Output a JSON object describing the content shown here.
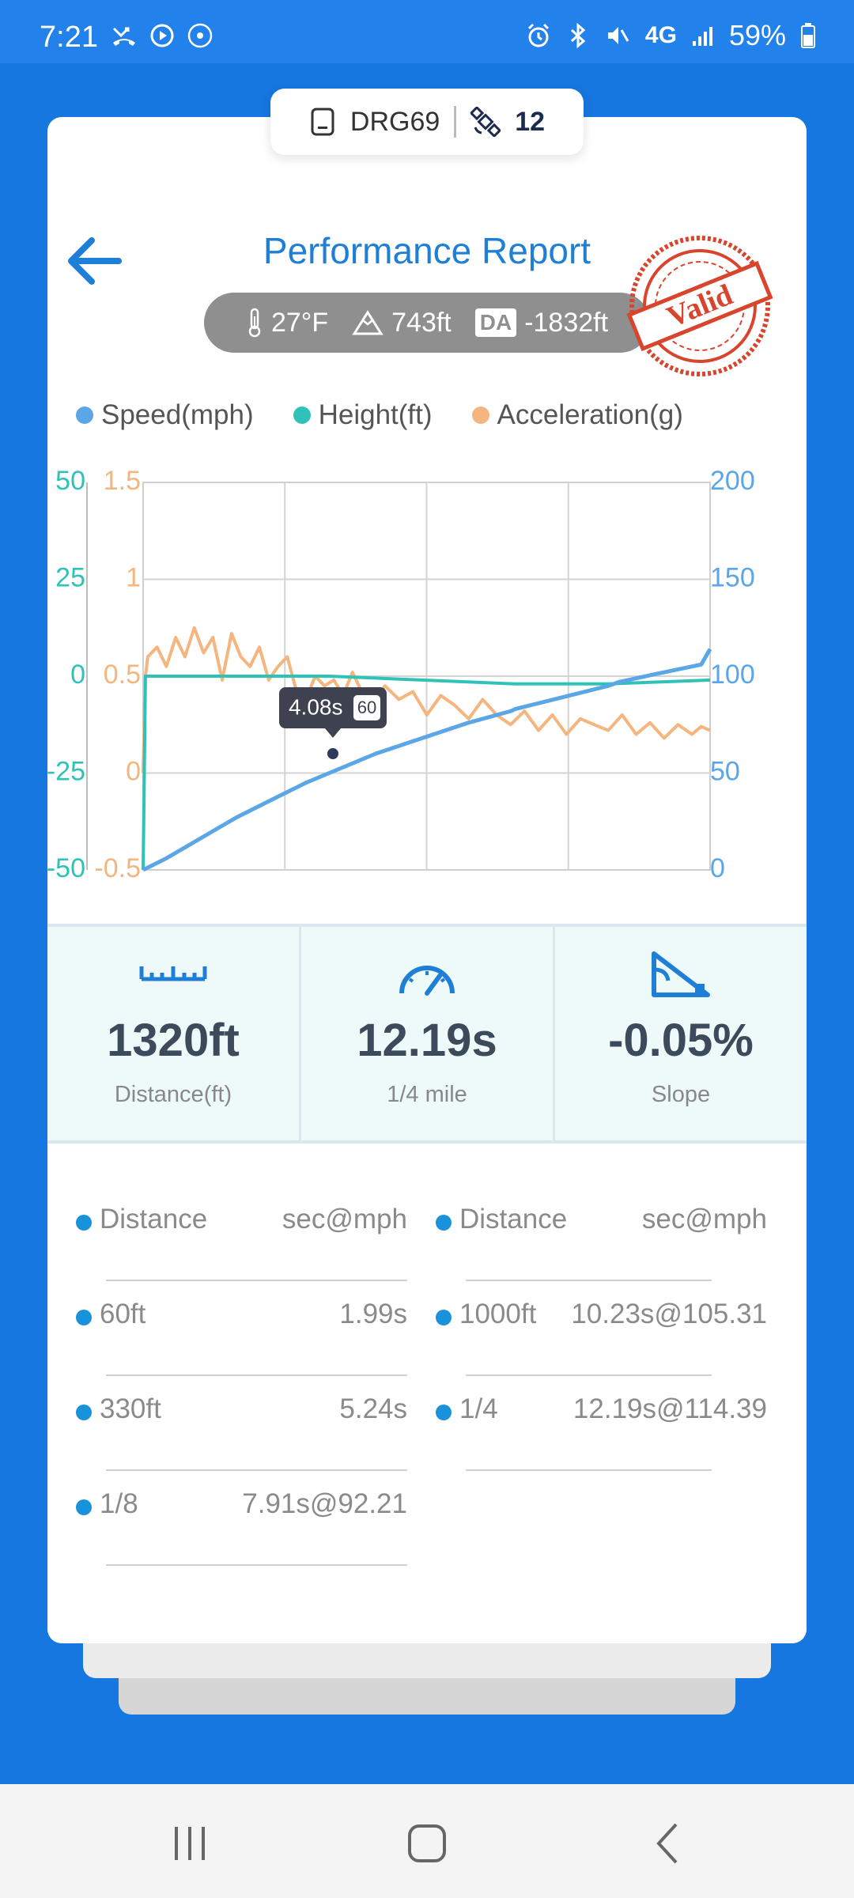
{
  "status_bar": {
    "time": "7:21",
    "network": "4G",
    "battery": "59%"
  },
  "device": {
    "id": "DRG69",
    "satellites": "12"
  },
  "header": {
    "title": "Performance Report",
    "stamp_text": "Valid"
  },
  "conditions": {
    "temperature": "27°F",
    "elevation": "743ft",
    "da_label": "DA",
    "density_altitude": "-1832ft"
  },
  "legend": {
    "speed": "Speed(mph)",
    "height": "Height(ft)",
    "acceleration": "Acceleration(g)"
  },
  "colors": {
    "speed": "#5aa6e6",
    "height": "#2fc2b8",
    "acceleration": "#f5b57e",
    "accent": "#1f7fd6"
  },
  "chart_data": {
    "type": "line",
    "x_range": [
      0,
      12.19
    ],
    "axes": {
      "height_ft": {
        "side": "left-outer",
        "range": [
          -50,
          50
        ],
        "ticks": [
          "50",
          "25",
          "0",
          "-25",
          "-50"
        ]
      },
      "acceleration_g": {
        "side": "left-inner",
        "range": [
          -0.5,
          1.5
        ],
        "ticks": [
          "1.5",
          "1",
          "0.5",
          "0",
          "-0.5"
        ]
      },
      "speed_mph": {
        "side": "right",
        "range": [
          0,
          200
        ],
        "ticks": [
          "200",
          "150",
          "100",
          "50",
          "0"
        ]
      }
    },
    "series": [
      {
        "name": "Speed(mph)",
        "axis": "speed_mph",
        "x": [
          0,
          0.5,
          1,
          1.5,
          2,
          2.5,
          3,
          3.5,
          4,
          4.5,
          5,
          6,
          7,
          7.91,
          8,
          9,
          10,
          10.23,
          11,
          12,
          12.19
        ],
        "y": [
          0,
          6,
          13,
          20,
          27,
          33,
          39,
          45,
          50,
          55,
          60,
          68,
          76,
          82,
          83,
          89,
          95,
          97,
          101,
          106,
          114
        ]
      },
      {
        "name": "Height(ft)",
        "axis": "height_ft",
        "x": [
          0,
          0.02,
          0.05,
          2,
          4,
          6,
          8,
          10,
          12.19
        ],
        "y": [
          -50,
          -30,
          0,
          0,
          0,
          -1,
          -2,
          -2,
          -1
        ]
      },
      {
        "name": "Acceleration(g)",
        "axis": "acceleration_g",
        "x": [
          0,
          0.05,
          0.1,
          0.3,
          0.5,
          0.7,
          0.9,
          1.1,
          1.3,
          1.5,
          1.7,
          1.9,
          2.1,
          2.3,
          2.5,
          2.7,
          2.9,
          3.1,
          3.3,
          3.5,
          3.7,
          3.9,
          4.1,
          4.3,
          4.5,
          4.7,
          4.9,
          5.2,
          5.5,
          5.8,
          6.1,
          6.4,
          6.7,
          7.0,
          7.3,
          7.6,
          7.9,
          8.2,
          8.5,
          8.8,
          9.1,
          9.4,
          9.7,
          10.0,
          10.3,
          10.6,
          10.9,
          11.2,
          11.5,
          11.8,
          12.0,
          12.19
        ],
        "y": [
          0.0,
          0.5,
          0.6,
          0.65,
          0.55,
          0.7,
          0.6,
          0.75,
          0.62,
          0.7,
          0.48,
          0.72,
          0.6,
          0.55,
          0.65,
          0.48,
          0.55,
          0.6,
          0.42,
          0.38,
          0.5,
          0.45,
          0.48,
          0.4,
          0.52,
          0.42,
          0.35,
          0.45,
          0.38,
          0.42,
          0.3,
          0.4,
          0.35,
          0.28,
          0.38,
          0.3,
          0.25,
          0.32,
          0.22,
          0.3,
          0.2,
          0.28,
          0.25,
          0.22,
          0.3,
          0.2,
          0.26,
          0.18,
          0.25,
          0.2,
          0.24,
          0.22
        ]
      }
    ],
    "tooltip": {
      "time": "4.08s",
      "speed": "60",
      "x": 4.08,
      "y": 60
    },
    "grid": true
  },
  "stats": {
    "distance": {
      "value": "1320ft",
      "label": "Distance(ft)"
    },
    "time": {
      "value": "12.19s",
      "label": "1/4 mile"
    },
    "slope": {
      "value": "-0.05%",
      "label": "Slope"
    }
  },
  "splits": {
    "header_left": {
      "name": "Distance",
      "value": "sec@mph"
    },
    "header_right": {
      "name": "Distance",
      "value": "sec@mph"
    },
    "left": [
      {
        "name": "60ft",
        "value": "1.99s"
      },
      {
        "name": "330ft",
        "value": "5.24s"
      },
      {
        "name": "1/8",
        "value": "7.91s@92.21"
      }
    ],
    "right": [
      {
        "name": "1000ft",
        "value": "10.23s@105.31"
      },
      {
        "name": "1/4",
        "value": "12.19s@114.39"
      }
    ]
  }
}
